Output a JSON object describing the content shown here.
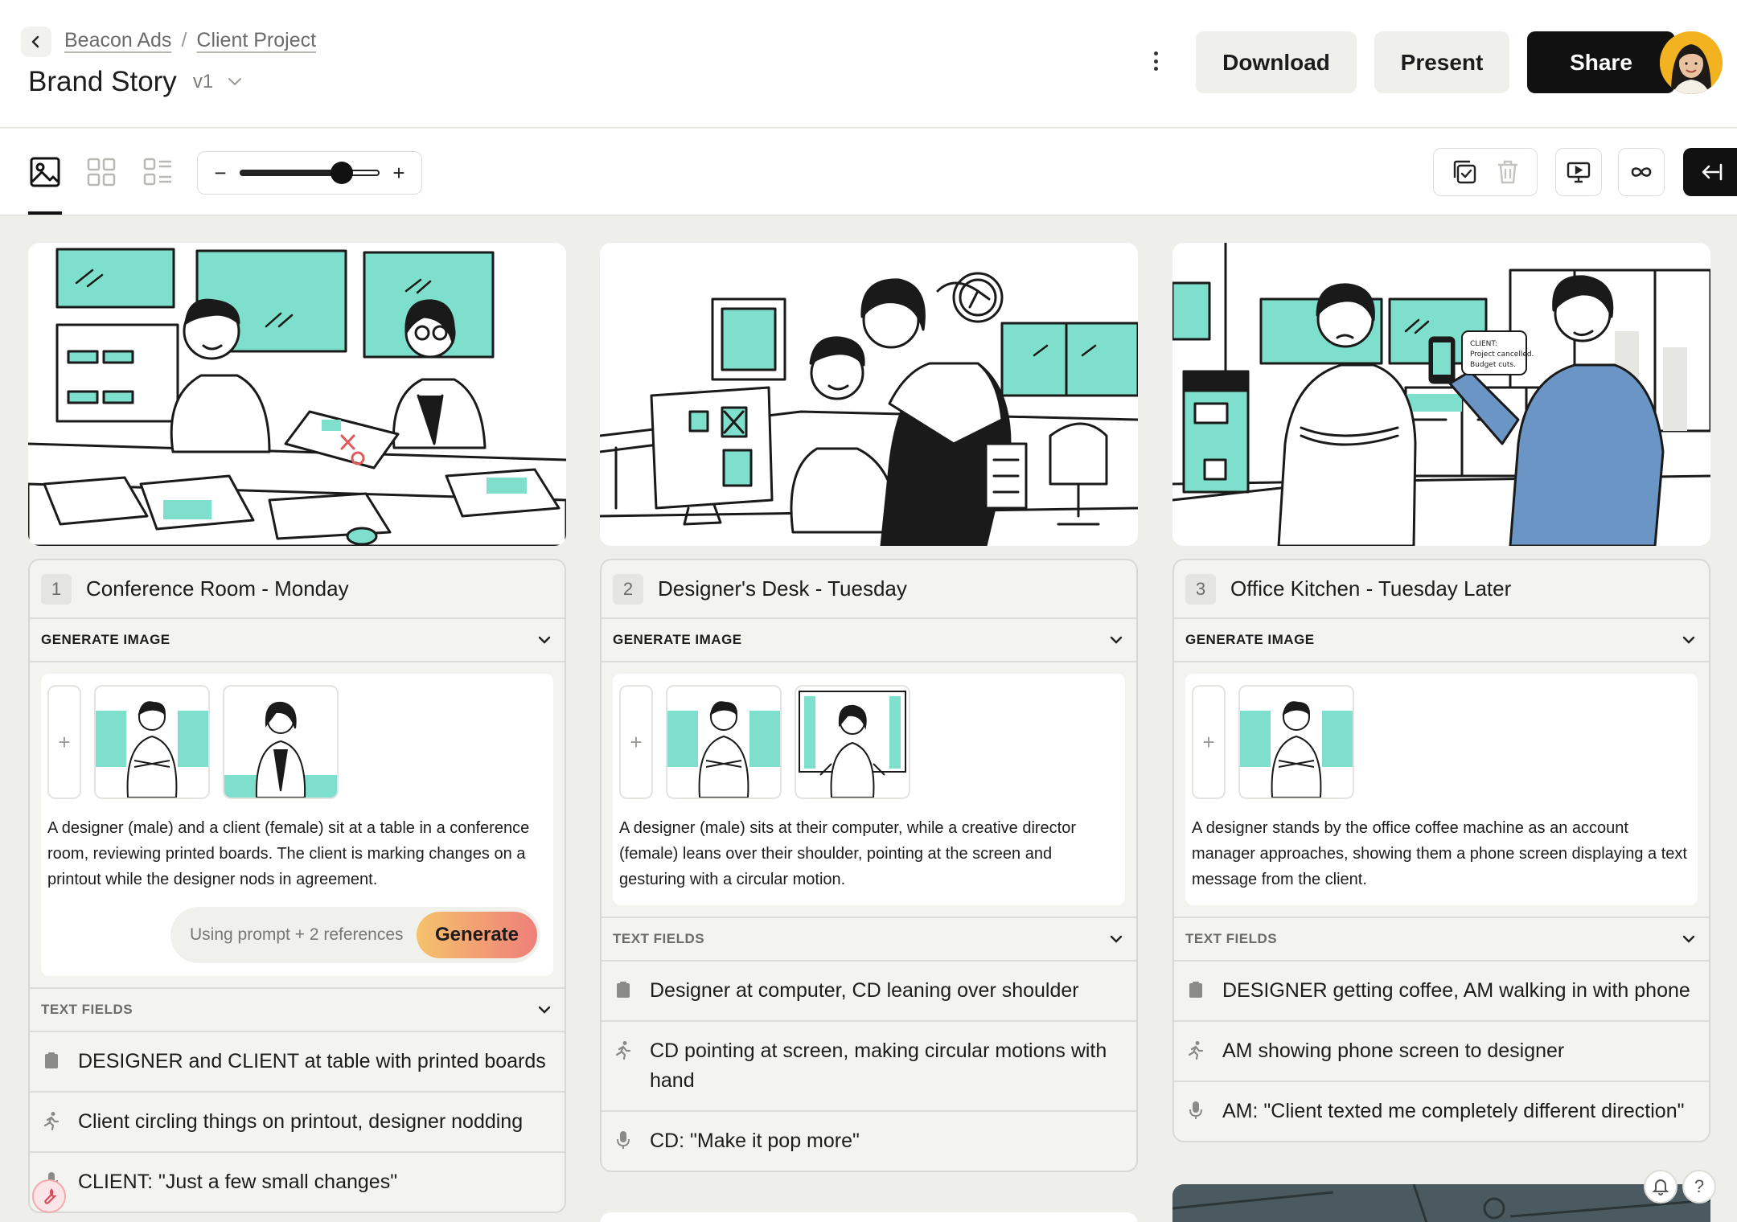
{
  "header": {
    "breadcrumb": [
      "Beacon Ads",
      "Client Project"
    ],
    "breadcrumb_separator": "/",
    "title": "Brand Story",
    "version": "v1",
    "actions": {
      "download": "Download",
      "present": "Present",
      "share": "Share"
    }
  },
  "toolbar": {
    "zoom_minus": "−",
    "zoom_plus": "+",
    "zoom_level": 0.73
  },
  "scenes": [
    {
      "number": "1",
      "title": "Conference Room - Monday",
      "generate_label": "GENERATE IMAGE",
      "prompt": "A designer (male) and a client (female) sit at a table in a conference room, reviewing printed boards. The client is marking changes on a printout while the designer nods in agreement.",
      "generate_hint": "Using prompt + 2 references",
      "generate_button": "Generate",
      "text_fields_label": "TEXT FIELDS",
      "fields": [
        {
          "icon": "clipboard-icon",
          "text": "DESIGNER and CLIENT at table with printed boards"
        },
        {
          "icon": "action-icon",
          "text": "Client circling things on printout, designer nodding"
        },
        {
          "icon": "mic-icon",
          "text": "CLIENT: \"Just a few small changes\""
        }
      ]
    },
    {
      "number": "2",
      "title": "Designer's Desk - Tuesday",
      "generate_label": "GENERATE IMAGE",
      "prompt": "A designer (male) sits at their computer, while a creative director (female) leans over their shoulder, pointing at the screen and gesturing with a circular motion.",
      "text_fields_label": "TEXT FIELDS",
      "fields": [
        {
          "icon": "clipboard-icon",
          "text": "Designer at computer, CD leaning over shoulder"
        },
        {
          "icon": "action-icon",
          "text": "CD pointing at screen, making circular motions with hand"
        },
        {
          "icon": "mic-icon",
          "text": "CD: \"Make it pop more\""
        }
      ]
    },
    {
      "number": "3",
      "title": "Office Kitchen - Tuesday Later",
      "generate_label": "GENERATE IMAGE",
      "prompt": "A designer stands by the office coffee machine as an account manager approaches, showing them a phone screen displaying a text message from the client.",
      "text_fields_label": "TEXT FIELDS",
      "phone_bubble": [
        "CLIENT:",
        "Project cancelled.",
        "Budget cuts."
      ],
      "fields": [
        {
          "icon": "clipboard-icon",
          "text": "DESIGNER getting coffee, AM walking in with phone"
        },
        {
          "icon": "action-icon",
          "text": "AM showing phone screen to designer"
        },
        {
          "icon": "mic-icon",
          "text": "AM: \"Client texted me completely different direction\""
        }
      ]
    }
  ],
  "help": "?",
  "colors": {
    "accent": "#7ee0cc",
    "primary": "#111111",
    "shirt_blue": "#6b95c4"
  }
}
